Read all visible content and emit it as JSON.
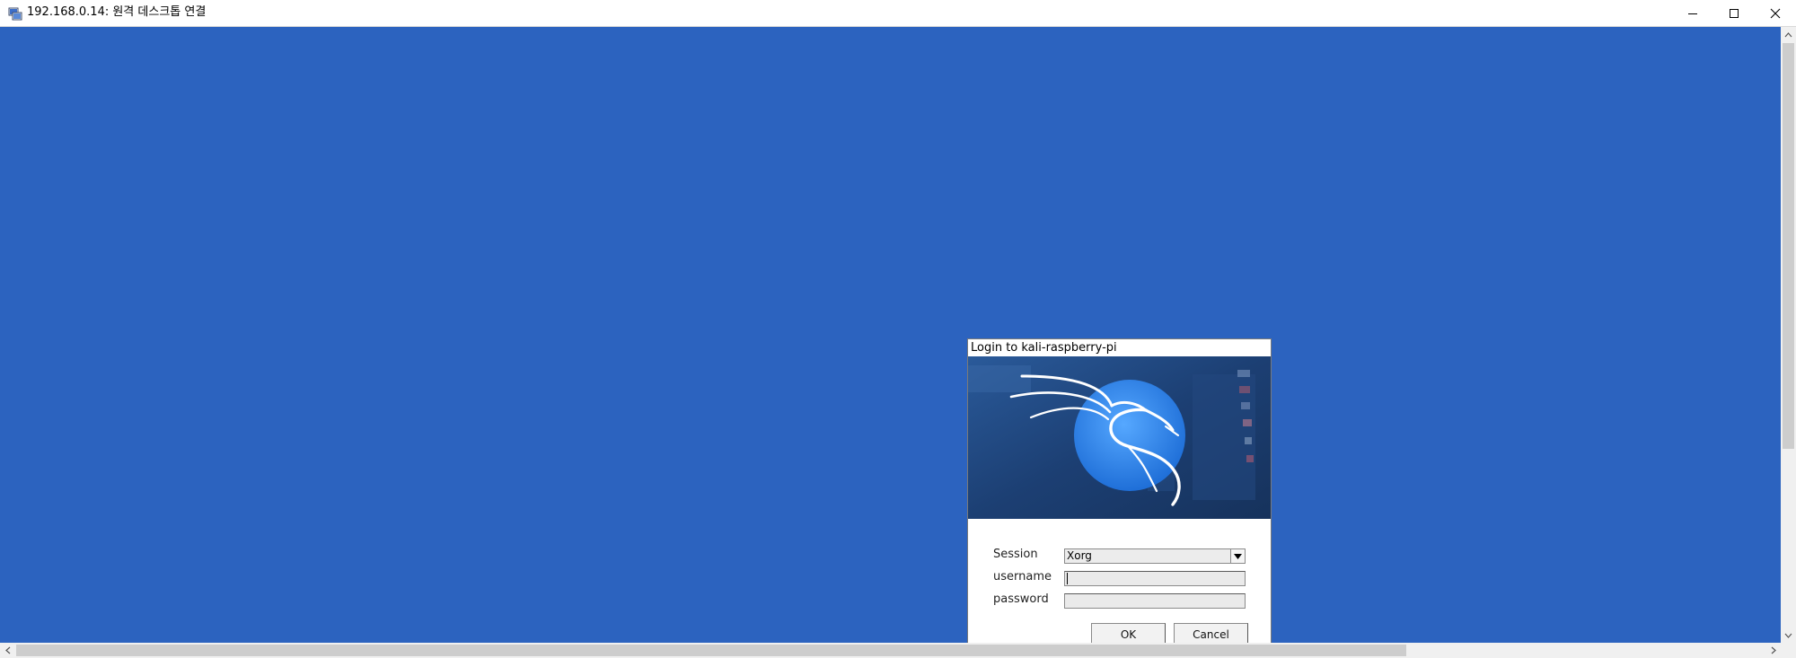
{
  "window": {
    "title": "192.168.0.14: 원격 데스크톱 연결",
    "icons": {
      "app": "remote-desktop-icon",
      "minimize": "minimize-icon",
      "maximize": "maximize-icon",
      "close": "close-icon"
    }
  },
  "dialog": {
    "title": "Login to kali-raspberry-pi",
    "banner": "kali-dragon-logo",
    "session": {
      "label": "Session",
      "value": "Xorg"
    },
    "username": {
      "label": "username",
      "value": ""
    },
    "password": {
      "label": "password",
      "value": ""
    },
    "ok_label": "OK",
    "cancel_label": "Cancel"
  },
  "colors": {
    "desktop": "#2c63bf",
    "banner_bg": "#1c3f73",
    "logo_circle": "#2f86e8"
  }
}
